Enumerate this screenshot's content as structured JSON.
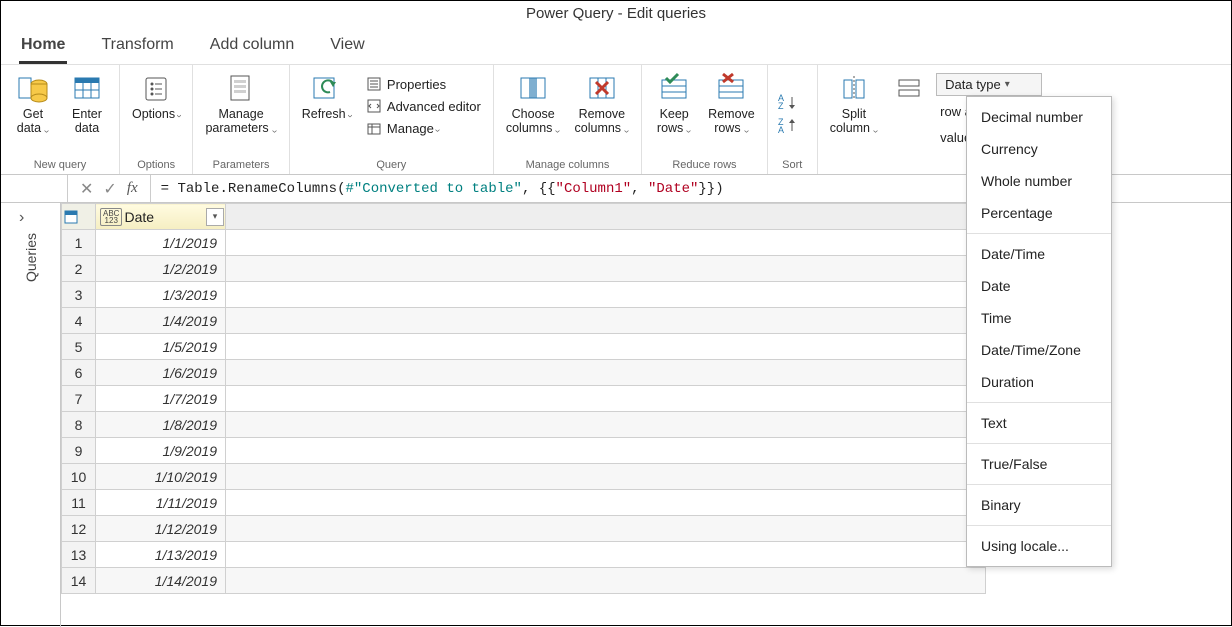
{
  "title": "Power Query - Edit queries",
  "tabs": [
    "Home",
    "Transform",
    "Add column",
    "View"
  ],
  "ribbon": {
    "new_query": {
      "label": "New query",
      "get_data": "Get\ndata",
      "enter_data": "Enter\ndata"
    },
    "options_group": {
      "label": "Options",
      "options": "Options"
    },
    "parameters_group": {
      "label": "Parameters",
      "manage_parameters": "Manage\nparameters"
    },
    "query_group": {
      "label": "Query",
      "refresh": "Refresh",
      "properties": "Properties",
      "advanced_editor": "Advanced editor",
      "manage": "Manage"
    },
    "manage_columns_group": {
      "label": "Manage columns",
      "choose_columns": "Choose\ncolumns",
      "remove_columns": "Remove\ncolumns"
    },
    "reduce_rows_group": {
      "label": "Reduce rows",
      "keep_rows": "Keep\nrows",
      "remove_rows": "Remove\nrows"
    },
    "sort_group": {
      "label": "Sort"
    },
    "transform_group": {
      "split_column": "Split\ncolumn",
      "data_type": "Data type",
      "row_headers": "row as headers",
      "values": "values"
    }
  },
  "formula": {
    "prefix": "= ",
    "func": "Table.RenameColumns",
    "ref": "#\"Converted to table\"",
    "col_from": "\"Column1\"",
    "col_to": "\"Date\""
  },
  "queries_pane_label": "Queries",
  "grid": {
    "column_header": "Date",
    "rows": [
      {
        "n": 1,
        "v": "1/1/2019"
      },
      {
        "n": 2,
        "v": "1/2/2019"
      },
      {
        "n": 3,
        "v": "1/3/2019"
      },
      {
        "n": 4,
        "v": "1/4/2019"
      },
      {
        "n": 5,
        "v": "1/5/2019"
      },
      {
        "n": 6,
        "v": "1/6/2019"
      },
      {
        "n": 7,
        "v": "1/7/2019"
      },
      {
        "n": 8,
        "v": "1/8/2019"
      },
      {
        "n": 9,
        "v": "1/9/2019"
      },
      {
        "n": 10,
        "v": "1/10/2019"
      },
      {
        "n": 11,
        "v": "1/11/2019"
      },
      {
        "n": 12,
        "v": "1/12/2019"
      },
      {
        "n": 13,
        "v": "1/13/2019"
      },
      {
        "n": 14,
        "v": "1/14/2019"
      }
    ]
  },
  "dropdown": {
    "items_a": [
      "Decimal number",
      "Currency",
      "Whole number",
      "Percentage"
    ],
    "items_b": [
      "Date/Time",
      "Date",
      "Time",
      "Date/Time/Zone",
      "Duration"
    ],
    "items_c": [
      "Text"
    ],
    "items_d": [
      "True/False"
    ],
    "items_e": [
      "Binary"
    ],
    "items_f": [
      "Using locale..."
    ]
  }
}
